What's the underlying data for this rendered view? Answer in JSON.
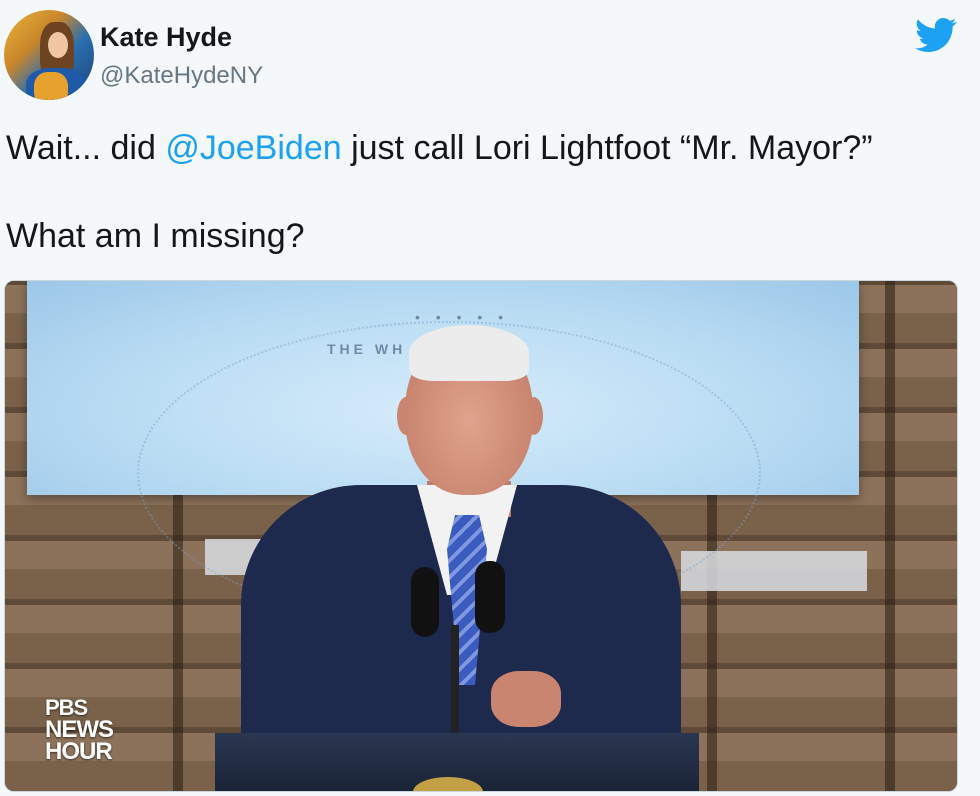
{
  "tweet": {
    "author_name": "Kate Hyde",
    "author_handle": "@KateHydeNY",
    "text_line1_before": "Wait... did ",
    "text_line1_mention": "@JoeBiden",
    "text_line1_after": " just call Lori Lightfoot “Mr. Mayor?”",
    "text_line2": "What am I missing?"
  },
  "media": {
    "watermark_line1": "PBS",
    "watermark_line2": "NEWS",
    "watermark_line3": "HOUR",
    "screen_text": "THE WH    USE",
    "screen_dots": "• • • • •"
  },
  "icons": {
    "brand": "twitter-bird-icon"
  },
  "colors": {
    "mention": "#1da1f2",
    "twitter_blue": "#1da1f2",
    "handle_gray": "#657786",
    "background": "#f5f8fa"
  }
}
